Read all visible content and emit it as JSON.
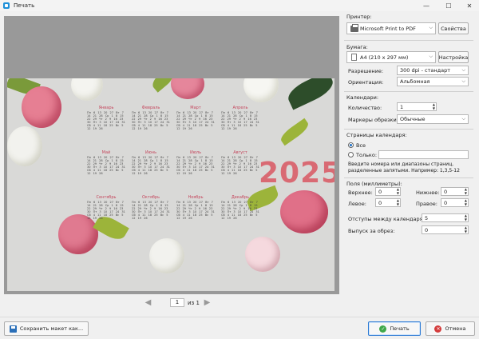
{
  "window": {
    "title": "Печать",
    "minimize": "—",
    "maximize": "☐",
    "close": "✕"
  },
  "preview": {
    "year": "2025",
    "months": [
      {
        "name": "Январь"
      },
      {
        "name": "Февраль"
      },
      {
        "name": "Март"
      },
      {
        "name": "Апрель"
      },
      {
        "name": "Май"
      },
      {
        "name": "Июнь"
      },
      {
        "name": "Июль"
      },
      {
        "name": "Август"
      },
      {
        "name": "Сентябрь"
      },
      {
        "name": "Октябрь"
      },
      {
        "name": "Ноябрь"
      },
      {
        "name": "Декабрь"
      }
    ],
    "days_sample": "Пн 6 13 20 27 Вт 7 14 21 28 Ср 1 8 15 22 29 Чт 2 9 16 23 30 Пт 3 10 17 24 31 Сб 4 11 18 25 Вс 5 12 19 26"
  },
  "pager": {
    "current": "1",
    "of_label": "из 1",
    "prev": "◀",
    "next": "▶"
  },
  "printer": {
    "section": "Принтер:",
    "name": "Microsoft Print to PDF",
    "properties_button": "Свойства"
  },
  "paper": {
    "section": "Бумага:",
    "size": "A4 (210 x 297 мм)",
    "setup_button": "Настройка",
    "resolution_label": "Разрешение:",
    "resolution_value": "300 dpi - стандарт",
    "orientation_label": "Ориентация:",
    "orientation_value": "Альбомная"
  },
  "calendars": {
    "section": "Календари:",
    "count_label": "Количество:",
    "count_value": "1",
    "markers_label": "Маркеры обрезки:",
    "markers_value": "Обычные"
  },
  "pages": {
    "section": "Страницы календаря:",
    "all_label": "Все",
    "only_label": "Только:",
    "hint": "Введите номера или диапазоны страниц, разделенные запятыми. Например: 1,3,5-12"
  },
  "margins": {
    "section": "Поля (миллиметры):",
    "top_label": "Верхнее:",
    "top_value": "0",
    "bottom_label": "Нижнее:",
    "bottom_value": "0",
    "left_label": "Левое:",
    "left_value": "0",
    "right_label": "Правое:",
    "right_value": "0",
    "gap_label": "Отступы между календарями:",
    "gap_value": "5",
    "bleed_label": "Выпуск за обрез:",
    "bleed_value": "0"
  },
  "footer": {
    "save_layout": "Сохранить макет как...",
    "print": "Печать",
    "cancel": "Отмена"
  }
}
